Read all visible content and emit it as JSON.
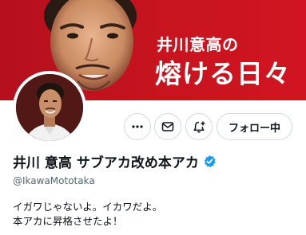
{
  "banner": {
    "title_line1": "井川意高の",
    "title_line2": "熔ける日々",
    "background_color": "#c8141f"
  },
  "profile": {
    "display_name": "井川 意高 サブアカ改め本アカ",
    "handle": "@IkawaMototaka",
    "verified": true,
    "bio_lines": [
      "イガワじゃないよ。イカワだよ。",
      "本アカに昇格させたよ！"
    ]
  },
  "actions": {
    "more_icon": "more-icon",
    "message_icon": "message-icon",
    "notify_icon": "notification-add-icon",
    "follow_label": "フォロー中"
  },
  "colors": {
    "verified_blue": "#1d9bf0",
    "text_primary": "#0f1419",
    "text_secondary": "#536471",
    "border": "#cfd9de"
  }
}
